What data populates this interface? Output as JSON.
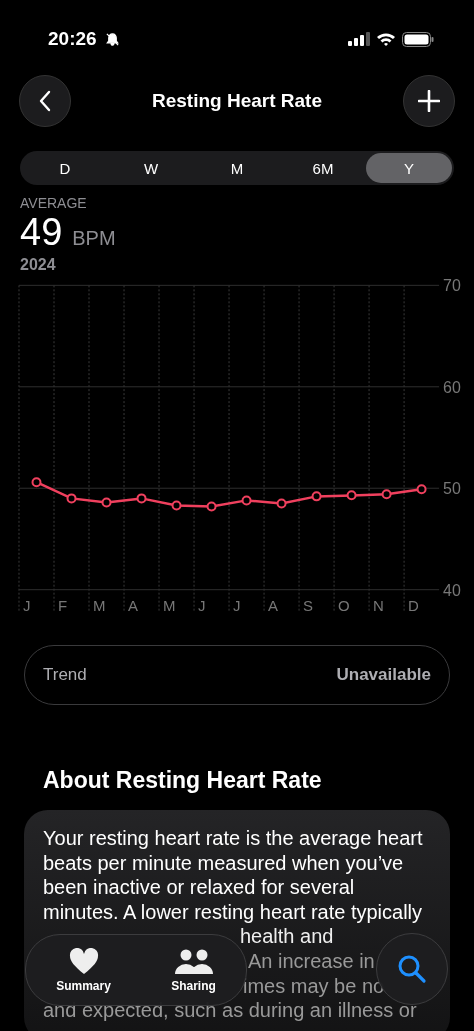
{
  "status_bar": {
    "time": "20:26"
  },
  "header": {
    "title": "Resting Heart Rate"
  },
  "ranges": [
    {
      "label": "D",
      "selected": false
    },
    {
      "label": "W",
      "selected": false
    },
    {
      "label": "M",
      "selected": false
    },
    {
      "label": "6M",
      "selected": false
    },
    {
      "label": "Y",
      "selected": true
    }
  ],
  "summary": {
    "caption": "AVERAGE",
    "value": "49",
    "unit": "BPM",
    "period": "2024"
  },
  "chart_data": {
    "type": "line",
    "categories": [
      "J",
      "F",
      "M",
      "A",
      "M",
      "J",
      "J",
      "A",
      "S",
      "O",
      "N",
      "D"
    ],
    "series": [
      {
        "color": "#f0405e",
        "marker": true,
        "values": [
          50.6,
          49.0,
          48.6,
          49.0,
          48.3,
          48.2,
          48.8,
          48.5,
          49.2,
          49.3,
          49.4,
          49.9
        ]
      }
    ],
    "ylim": [
      40,
      70
    ],
    "yticks": [
      40,
      50,
      60,
      70
    ]
  },
  "trend": {
    "label": "Trend",
    "value": "Unavailable"
  },
  "about": {
    "title": "About Resting Heart Rate",
    "lines": [
      "Your resting heart rate is the average heart beats per minute measured when you’ve been inactive or relaxed for several minutes. A lower resting heart rate typically"
    ],
    "partial_lines": [
      "health and",
      "An increase in",
      "imes may be no",
      "and expected, such as during an illness or"
    ]
  },
  "tab_bar": [
    {
      "label": "Summary"
    },
    {
      "label": "Sharing"
    }
  ]
}
